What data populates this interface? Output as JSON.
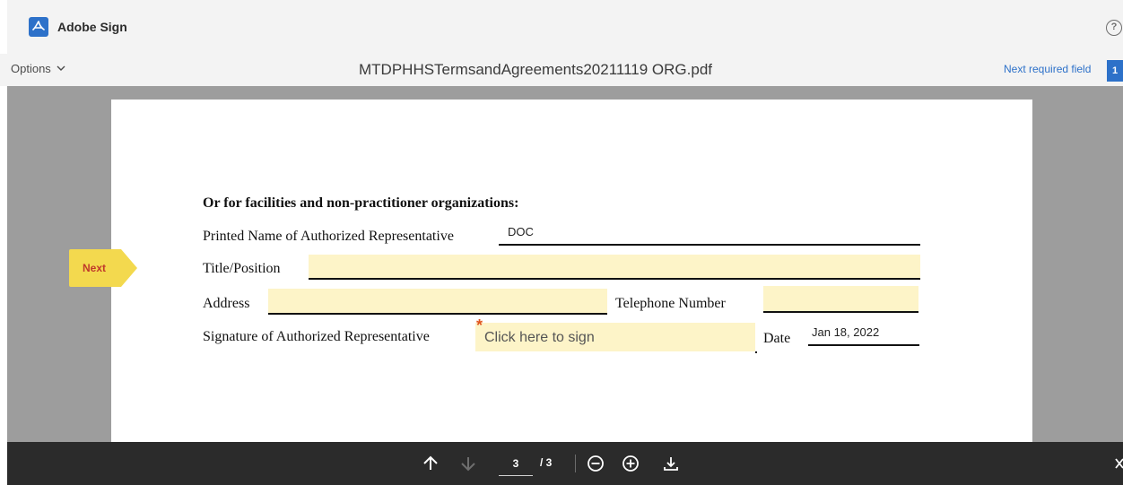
{
  "app": {
    "name": "Adobe Sign",
    "help_icon": "help-circle-icon"
  },
  "header": {
    "options_label": "Options",
    "document_title": "MTDPHHSTermsandAgreements20211119 ORG.pdf",
    "next_required_label": "Next required field",
    "next_required_count": "1"
  },
  "document": {
    "heading": "Or for facilities and non-practitioner organizations:",
    "printed_name_label": "Printed Name of Authorized Representative",
    "printed_name_value": "DOC",
    "title_label": "Title/Position",
    "title_value": "",
    "address_label": "Address",
    "address_value": "",
    "telephone_label": "Telephone Number",
    "telephone_value": "",
    "signature_label": "Signature of Authorized Representative",
    "signature_placeholder": "Click here to sign",
    "required_marker": "*",
    "date_label": "Date",
    "date_value": "Jan 18, 2022"
  },
  "next_tag_label": "Next",
  "toolbar": {
    "current_page": "3",
    "total_pages": "/ 3"
  },
  "colors": {
    "accent": "#2d71c9",
    "field_highlight": "#fdf4c8",
    "next_tag": "#f3d94e",
    "toolbar_bg": "#2b2b2b"
  }
}
